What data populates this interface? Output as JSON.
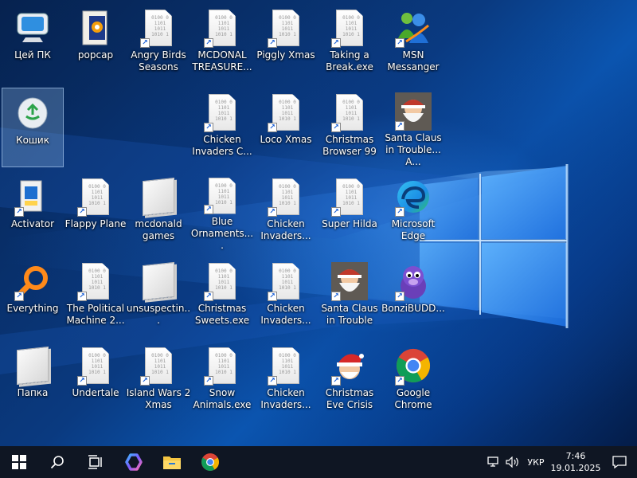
{
  "desktop": {
    "icons": [
      {
        "label": "Цей ПК",
        "icon": "this-pc-icon"
      },
      {
        "label": "popcap",
        "icon": "popcap-icon"
      },
      {
        "label": "Angry Birds Seasons",
        "icon": "binary-file-icon"
      },
      {
        "label": "MCDONAL TREASURE...",
        "icon": "binary-file-icon"
      },
      {
        "label": "Piggly Xmas",
        "icon": "binary-file-icon"
      },
      {
        "label": "Taking a Break.exe",
        "icon": "binary-file-icon"
      },
      {
        "label": "MSN Messanger",
        "icon": "msn-messenger-icon"
      },
      {
        "label": "Кошик",
        "icon": "recycle-bin-icon"
      },
      {
        "label": "Chicken Invaders C...",
        "icon": "binary-file-icon"
      },
      {
        "label": "Loco Xmas",
        "icon": "binary-file-icon"
      },
      {
        "label": "Christmas Browser 99",
        "icon": "binary-file-icon"
      },
      {
        "label": "Santa Claus in Trouble... A...",
        "icon": "santa-claus-icon"
      },
      {
        "label": "Activator",
        "icon": "activator-icon"
      },
      {
        "label": "Flappy Plane",
        "icon": "binary-file-icon"
      },
      {
        "label": "mcdonald games",
        "icon": "folder-icon"
      },
      {
        "label": "Blue Ornaments....",
        "icon": "binary-file-icon"
      },
      {
        "label": "Chicken Invaders...",
        "icon": "binary-file-icon"
      },
      {
        "label": "Super Hilda",
        "icon": "binary-file-icon"
      },
      {
        "label": "Microsoft Edge",
        "icon": "edge-icon"
      },
      {
        "label": "Everything",
        "icon": "everything-search-icon"
      },
      {
        "label": "The Political Machine 2...",
        "icon": "binary-file-icon"
      },
      {
        "label": "unsuspectin...",
        "icon": "folder-icon"
      },
      {
        "label": "Christmas Sweets.exe",
        "icon": "binary-file-icon"
      },
      {
        "label": "Chicken Invaders...",
        "icon": "binary-file-icon"
      },
      {
        "label": "Santa Claus in Trouble",
        "icon": "santa-claus-icon"
      },
      {
        "label": "BonziBUDD...",
        "icon": "bonzi-buddy-icon"
      },
      {
        "label": "Папка",
        "icon": "folder-icon"
      },
      {
        "label": "Undertale",
        "icon": "binary-file-icon"
      },
      {
        "label": "Island Wars 2 Xmas",
        "icon": "binary-file-icon"
      },
      {
        "label": "Snow Animals.exe",
        "icon": "binary-file-icon"
      },
      {
        "label": "Chicken Invaders...",
        "icon": "binary-file-icon"
      },
      {
        "label": "Christmas Eve Crisis",
        "icon": "santa-hat-icon"
      },
      {
        "label": "Google Chrome",
        "icon": "chrome-icon"
      }
    ]
  },
  "taskbar": {
    "buttons": [
      "start-icon",
      "search-icon",
      "task-view-icon",
      "copilot-icon",
      "file-explorer-icon",
      "chrome-icon"
    ],
    "tray": {
      "language": "УКР",
      "time": "7:46",
      "date": "19.01.2025"
    }
  },
  "colors": {
    "taskbar": "#0f1623",
    "wallpaper_accent": "#2f8fff"
  }
}
